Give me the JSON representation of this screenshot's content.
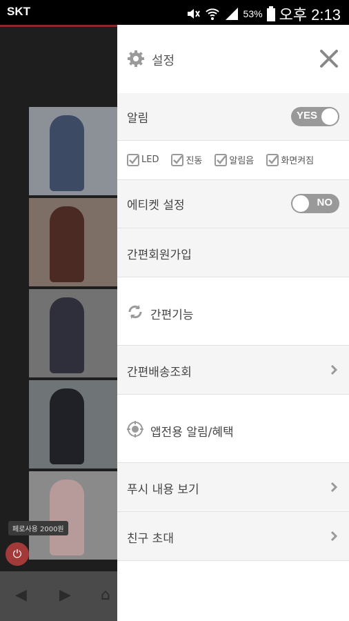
{
  "status_bar": {
    "carrier": "SKT",
    "battery": "53%",
    "time": "오후 2:13"
  },
  "background_app": {
    "coupon_label": "페로사용 2000원"
  },
  "drawer": {
    "title": "설정",
    "rows": {
      "notification_label": "알림",
      "notification_toggle": "YES",
      "options": [
        "LED",
        "진동",
        "알림음",
        "화면켜짐"
      ],
      "etiquette_label": "에티켓 설정",
      "etiquette_toggle": "NO",
      "quick_signup": "간편회원가입",
      "quick_functions": "간편기능",
      "quick_delivery": "간편배송조회",
      "app_exclusive": "앱전용 알림/혜택",
      "push_view": "푸시 내용 보기",
      "invite_friend": "친구 초대"
    }
  },
  "colors": {
    "toggle_bg": "#999999",
    "drawer_bg": "#ffffff",
    "row_gray": "#f5f5f5"
  }
}
